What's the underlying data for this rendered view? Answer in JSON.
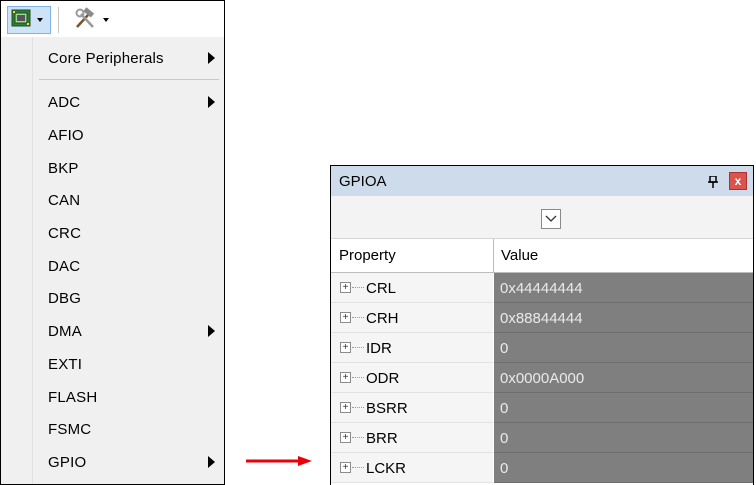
{
  "toolbar": {
    "peripherals_icon": "peripherals-board-icon",
    "tools_icon": "hammer-wrench-icon"
  },
  "menu": {
    "items": [
      {
        "label": "Core Peripherals",
        "submenu": true
      },
      {
        "label": "ADC",
        "submenu": true
      },
      {
        "label": "AFIO",
        "submenu": false
      },
      {
        "label": "BKP",
        "submenu": false
      },
      {
        "label": "CAN",
        "submenu": false
      },
      {
        "label": "CRC",
        "submenu": false
      },
      {
        "label": "DAC",
        "submenu": false
      },
      {
        "label": "DBG",
        "submenu": false
      },
      {
        "label": "DMA",
        "submenu": true
      },
      {
        "label": "EXTI",
        "submenu": false
      },
      {
        "label": "FLASH",
        "submenu": false
      },
      {
        "label": "FSMC",
        "submenu": false
      },
      {
        "label": "GPIO",
        "submenu": true
      }
    ]
  },
  "window": {
    "title": "GPIOA",
    "close_label": "x",
    "columns": {
      "property": "Property",
      "value": "Value"
    },
    "rows": [
      {
        "name": "CRL",
        "value": "0x44444444"
      },
      {
        "name": "CRH",
        "value": "0x88844444"
      },
      {
        "name": "IDR",
        "value": "0"
      },
      {
        "name": "ODR",
        "value": "0x0000A000"
      },
      {
        "name": "BSRR",
        "value": "0"
      },
      {
        "name": "BRR",
        "value": "0"
      },
      {
        "name": "LCKR",
        "value": "0"
      }
    ]
  },
  "colors": {
    "titlebar": "#cedbeb",
    "value_cell": "#7f7f7f",
    "arrow": "#e8000b",
    "close_button": "#d9534f"
  }
}
